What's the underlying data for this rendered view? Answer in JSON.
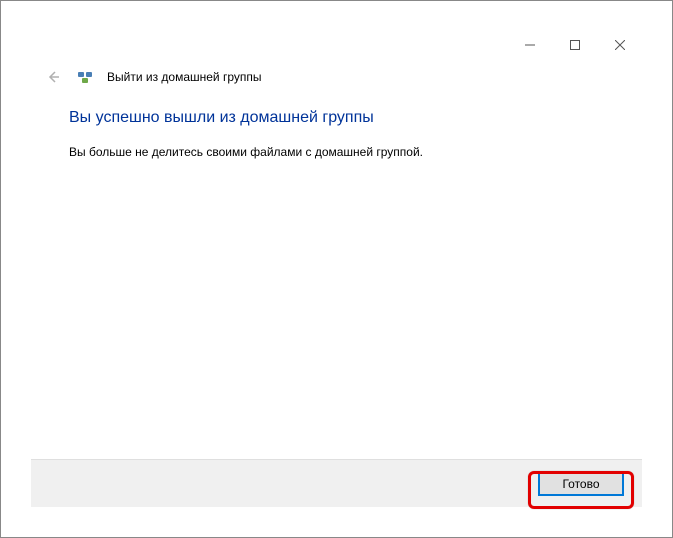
{
  "window": {
    "breadcrumb": "Выйти из домашней группы"
  },
  "content": {
    "heading": "Вы успешно вышли из домашней группы",
    "body": "Вы больше не делитесь своими файлами с домашней группой."
  },
  "footer": {
    "done_label": "Готово"
  }
}
